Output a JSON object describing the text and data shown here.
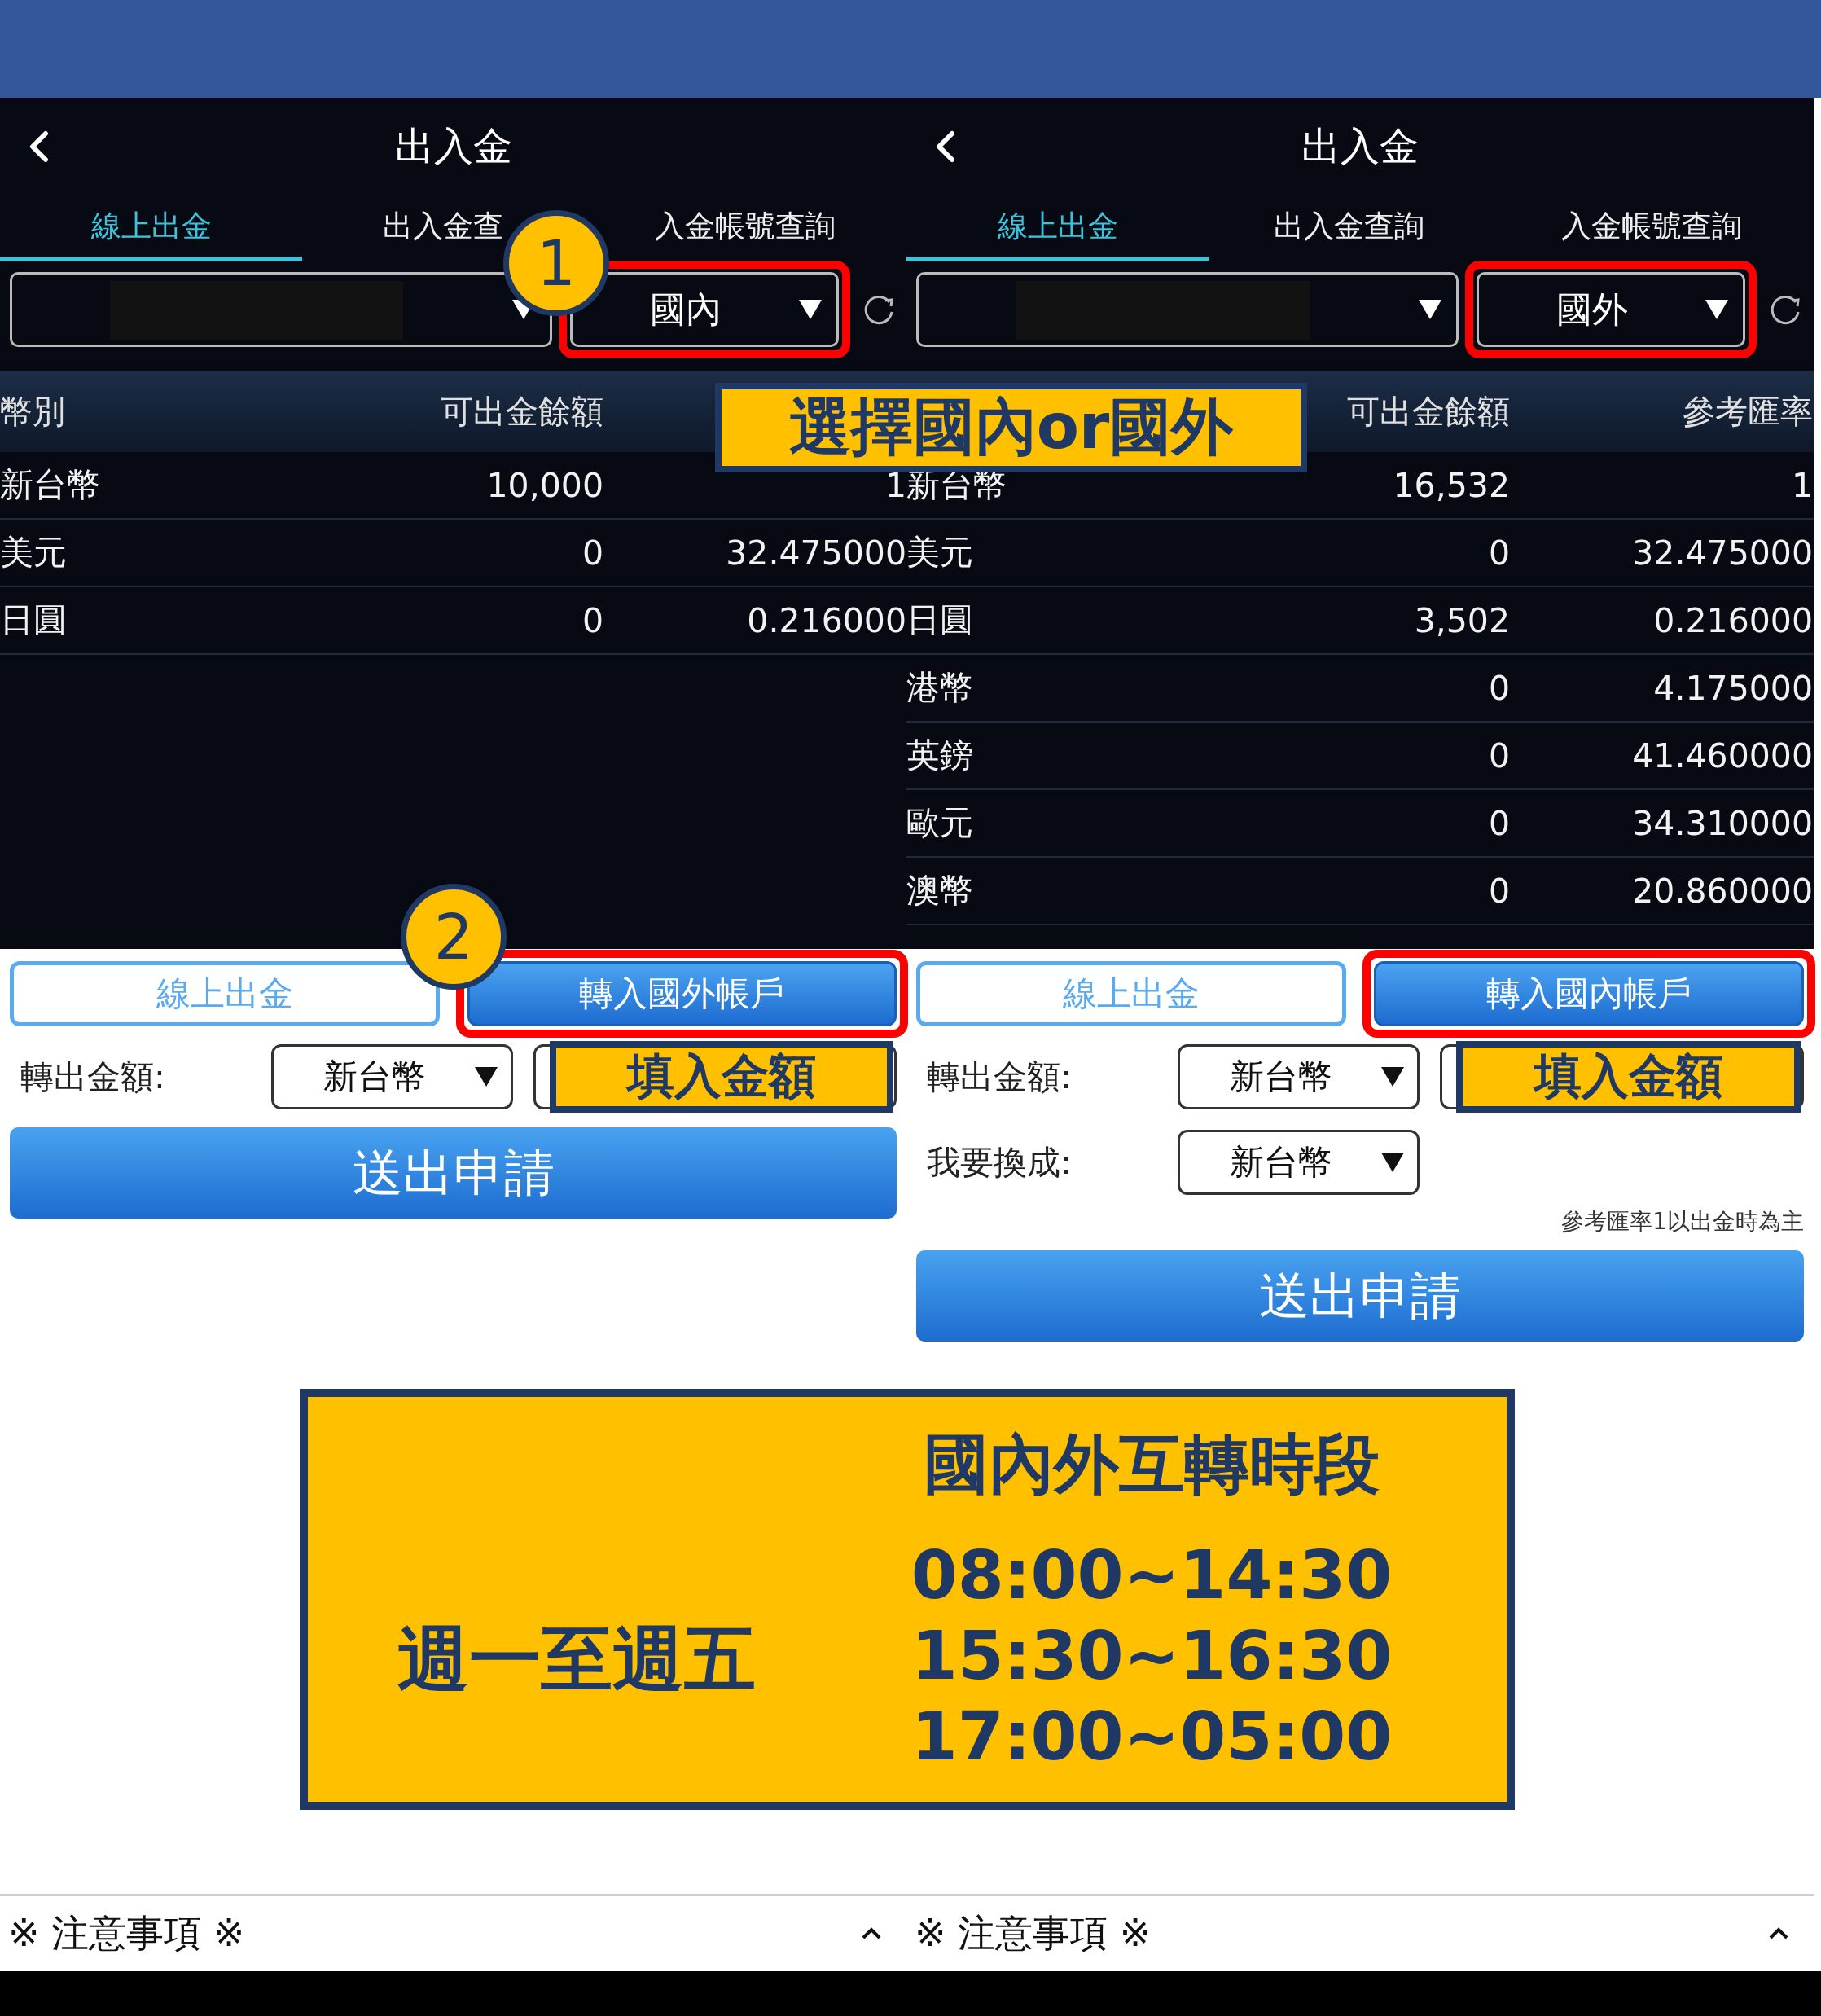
{
  "panels": [
    {
      "title": "出入金",
      "tabs": [
        {
          "label": "線上出金",
          "selected": true
        },
        {
          "label": "出入金查",
          "selected": false
        },
        {
          "label": "入金帳號查詢",
          "selected": false
        }
      ],
      "region_select": {
        "value": "國內",
        "highlighted": true
      },
      "table_header": {
        "currency": "幣別",
        "balance": "可出金餘額"
      },
      "rows": [
        {
          "currency": "新台幣",
          "balance": "10,000",
          "rate": "1"
        },
        {
          "currency": "美元",
          "balance": "0",
          "rate": "32.475000"
        },
        {
          "currency": "日圓",
          "balance": "0",
          "rate": "0.216000"
        }
      ],
      "action_buttons": [
        {
          "label": "線上出金",
          "selected": false,
          "highlighted": false
        },
        {
          "label": "轉入國外帳戶",
          "selected": true,
          "highlighted": true
        }
      ],
      "form_rows": [
        {
          "kind": "amount",
          "label": "轉出金額:",
          "currency": "新台幣",
          "callout": "填入金額"
        }
      ],
      "submit": "送出申請",
      "notice": "※ 注意事項 ※"
    },
    {
      "title": "出入金",
      "tabs": [
        {
          "label": "線上出金",
          "selected": true
        },
        {
          "label": "出入金查詢",
          "selected": false
        },
        {
          "label": "入金帳號查詢",
          "selected": false
        }
      ],
      "region_select": {
        "value": "國外",
        "highlighted": true
      },
      "table_header": {
        "balance": "可出金餘額",
        "rate": "參考匯率"
      },
      "rows": [
        {
          "currency": "新台幣",
          "balance": "16,532",
          "rate": "1"
        },
        {
          "currency": "美元",
          "balance": "0",
          "rate": "32.475000"
        },
        {
          "currency": "日圓",
          "balance": "3,502",
          "rate": "0.216000"
        },
        {
          "currency": "港幣",
          "balance": "0",
          "rate": "4.175000"
        },
        {
          "currency": "英鎊",
          "balance": "0",
          "rate": "41.460000"
        },
        {
          "currency": "歐元",
          "balance": "0",
          "rate": "34.310000"
        },
        {
          "currency": "澳幣",
          "balance": "0",
          "rate": "20.860000"
        }
      ],
      "action_buttons": [
        {
          "label": "線上出金",
          "selected": false,
          "highlighted": false
        },
        {
          "label": "轉入國內帳戶",
          "selected": true,
          "highlighted": true
        }
      ],
      "form_rows": [
        {
          "kind": "amount",
          "label": "轉出金額:",
          "currency": "新台幣",
          "callout": "填入金額"
        },
        {
          "kind": "select",
          "label": "我要換成:",
          "currency": "新台幣"
        }
      ],
      "note": "參考匯率1以出金時為主",
      "submit": "送出申請",
      "notice": "※ 注意事項 ※"
    }
  ],
  "annotations": {
    "step_badges": [
      "1",
      "2"
    ],
    "region_callout": "選擇國內or國外",
    "schedule": {
      "title": "國內外互轉時段",
      "days": "週一至週五",
      "times": [
        "08:00~14:30",
        "15:30~16:30",
        "17:00~05:00"
      ]
    }
  }
}
